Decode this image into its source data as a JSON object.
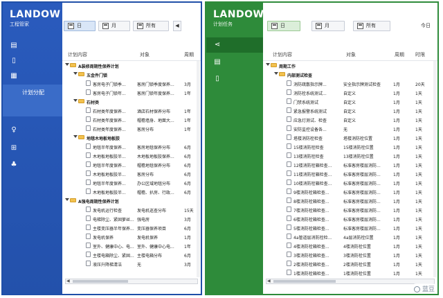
{
  "left": {
    "brand": {
      "logo": "LANDOW",
      "sub": "工程管家"
    },
    "nav": {
      "active_label": "计划分配"
    },
    "toolbar": {
      "day": "日",
      "month": "月",
      "all": "所有",
      "arrow_left": "◀"
    },
    "headers": {
      "content": "计划内容",
      "object": "对象",
      "period": "周期"
    },
    "rows": [
      {
        "level": 0,
        "kind": "group",
        "name": "A装修周期性保养计划",
        "object": "",
        "period": ""
      },
      {
        "level": 1,
        "kind": "group",
        "name": "五金件门锁",
        "object": "",
        "period": ""
      },
      {
        "level": 2,
        "kind": "item",
        "name": "客房电子门锁季...",
        "object": "客房门锁季度保养...",
        "period": "3月"
      },
      {
        "level": 2,
        "kind": "item",
        "name": "客房电子门锁年...",
        "object": "客房门锁年度保养...",
        "period": "1年"
      },
      {
        "level": 1,
        "kind": "group",
        "name": "石材类",
        "object": "",
        "period": ""
      },
      {
        "level": 2,
        "kind": "item",
        "name": "石材类年度保养...",
        "object": "酒店石材保养分布",
        "period": "1年"
      },
      {
        "level": 2,
        "kind": "item",
        "name": "石材类年度保养...",
        "object": "帽檐墙身、地面大...",
        "period": "1年"
      },
      {
        "level": 2,
        "kind": "item",
        "name": "石材类年度保养...",
        "object": "客房分布",
        "period": "1年"
      },
      {
        "level": 1,
        "kind": "group",
        "name": "地毯木地板地板胶",
        "object": "",
        "period": ""
      },
      {
        "level": 2,
        "kind": "item",
        "name": "地毯半年度保养...",
        "object": "客房地毯保养分布",
        "period": "6月"
      },
      {
        "level": 2,
        "kind": "item",
        "name": "木地板地板胶半...",
        "object": "木地板地板胶保养...",
        "period": "6月"
      },
      {
        "level": 2,
        "kind": "item",
        "name": "地毯半年度保养...",
        "object": "帽檐地毯保养分布",
        "period": "6月"
      },
      {
        "level": 2,
        "kind": "item",
        "name": "木地板地板胶半...",
        "object": "客房分布",
        "period": "6月"
      },
      {
        "level": 2,
        "kind": "item",
        "name": "地毯半年度保养...",
        "object": "办公区域地毯分布",
        "period": "6月"
      },
      {
        "level": 2,
        "kind": "item",
        "name": "木地板地板胶半...",
        "object": "帽檐、扒房、行政...",
        "period": "6月"
      },
      {
        "level": 0,
        "kind": "group",
        "name": "A强电周期性保养计划",
        "object": "",
        "period": ""
      },
      {
        "level": 2,
        "kind": "item",
        "name": "发电机运行检查",
        "object": "发电机巡查分布",
        "period": "15天"
      },
      {
        "level": 2,
        "kind": "item",
        "name": "电梯除尘、紧固萝丝...",
        "object": "强电房",
        "period": "3月"
      },
      {
        "level": 2,
        "kind": "item",
        "name": "主楼变压器半年保养...",
        "object": "变压器保养项目",
        "period": "6月"
      },
      {
        "level": 2,
        "kind": "item",
        "name": "发电机保养",
        "object": "发电机保养",
        "period": "1月"
      },
      {
        "level": 2,
        "kind": "item",
        "name": "室外、健康中心、电...",
        "object": "室外、健康中心电...",
        "period": "1年"
      },
      {
        "level": 2,
        "kind": "item",
        "name": "主楼电箱除尘、紧固...",
        "object": "主楼电箱分布",
        "period": "6月"
      },
      {
        "level": 2,
        "kind": "item",
        "name": "液压升降梯清洁",
        "object": "无",
        "period": "3月"
      }
    ]
  },
  "right": {
    "brand": {
      "logo": "LANDOW",
      "sub": "计划任务"
    },
    "toolbar": {
      "day": "日",
      "month": "月",
      "all": "所有",
      "today": "今日"
    },
    "headers": {
      "content": "计划内容",
      "object": "对象",
      "period": "周期",
      "time": "时限"
    },
    "rows": [
      {
        "level": 0,
        "kind": "group",
        "name": "周期工作",
        "object": "",
        "period": "",
        "time": ""
      },
      {
        "level": 1,
        "kind": "group",
        "name": "内部测试检查",
        "object": "",
        "period": "",
        "time": ""
      },
      {
        "level": 2,
        "kind": "item",
        "name": "消防疏散指示牌...",
        "object": "安全指示牌测试检查",
        "period": "1月",
        "time": "20天"
      },
      {
        "level": 2,
        "kind": "item",
        "name": "消防栓系统测试...",
        "object": "自定义",
        "period": "1月",
        "time": "1天"
      },
      {
        "level": 2,
        "kind": "item",
        "name": "门禁系统测试",
        "object": "自定义",
        "period": "1月",
        "time": "1天"
      },
      {
        "level": 2,
        "kind": "item",
        "name": "紧急报警系统测试",
        "object": "自定义",
        "period": "1月",
        "time": "1天"
      },
      {
        "level": 2,
        "kind": "item",
        "name": "应急灯测试、检查",
        "object": "自定义",
        "period": "1月",
        "time": "1天"
      },
      {
        "level": 2,
        "kind": "item",
        "name": "安防监控设备各...",
        "object": "无",
        "period": "1月",
        "time": "1天"
      },
      {
        "level": 2,
        "kind": "item",
        "name": "塔楼消防栓检查",
        "object": "塔楼消防栓位置",
        "period": "1月",
        "time": "1天"
      },
      {
        "level": 2,
        "kind": "item",
        "name": "15楼消防栓检查",
        "object": "15楼消防栓位置",
        "period": "1月",
        "time": "1天"
      },
      {
        "level": 2,
        "kind": "item",
        "name": "13楼消防栓检查",
        "object": "13楼消防栓位置",
        "period": "1月",
        "time": "1天"
      },
      {
        "level": 2,
        "kind": "item",
        "name": "12楼消防栓箱检查...",
        "object": "标准客房楼层消防...",
        "period": "1月",
        "time": "1天"
      },
      {
        "level": 2,
        "kind": "item",
        "name": "11楼消防栓箱检查...",
        "object": "标准客房楼层消防...",
        "period": "1月",
        "time": "1天"
      },
      {
        "level": 2,
        "kind": "item",
        "name": "10楼消防栓箱检查...",
        "object": "标准客房楼层消防...",
        "period": "1月",
        "time": "1天"
      },
      {
        "level": 2,
        "kind": "item",
        "name": "9楼消防栓箱检查...",
        "object": "标准客房楼层消防...",
        "period": "1月",
        "time": "1天"
      },
      {
        "level": 2,
        "kind": "item",
        "name": "8楼消防栓箱检查...",
        "object": "标准客房楼层消防...",
        "period": "1月",
        "time": "1天"
      },
      {
        "level": 2,
        "kind": "item",
        "name": "7楼消防栓箱检查...",
        "object": "标准客房楼层消防...",
        "period": "1月",
        "time": "1天"
      },
      {
        "level": 2,
        "kind": "item",
        "name": "6楼消防栓箱检查...",
        "object": "标准客房楼层消防...",
        "period": "1月",
        "time": "1天"
      },
      {
        "level": 2,
        "kind": "item",
        "name": "5楼消防栓箱检查...",
        "object": "标准客房楼层消防...",
        "period": "1月",
        "time": "1天"
      },
      {
        "level": 2,
        "kind": "item",
        "name": "4a管道层消防栓检...",
        "object": "4a层消防栓位置",
        "period": "1月",
        "time": "1天"
      },
      {
        "level": 2,
        "kind": "item",
        "name": "4楼消防栓箱检查...",
        "object": "4楼消防栓位置",
        "period": "1月",
        "time": "1天"
      },
      {
        "level": 2,
        "kind": "item",
        "name": "3楼消防栓箱检查...",
        "object": "3楼消防栓位置",
        "period": "1月",
        "time": "1天"
      },
      {
        "level": 2,
        "kind": "item",
        "name": "2楼消防栓箱检查...",
        "object": "2楼消防栓位置",
        "period": "1月",
        "time": "1天"
      },
      {
        "level": 2,
        "kind": "item",
        "name": "1楼消防栓箱检查...",
        "object": "1楼消防栓位置",
        "period": "1月",
        "time": "1天"
      }
    ]
  },
  "watermark": "蓝豆",
  "colors": {
    "left_accent": "#2a5bbd",
    "right_accent": "#2e8b3a",
    "folder": "#f2c14e"
  }
}
